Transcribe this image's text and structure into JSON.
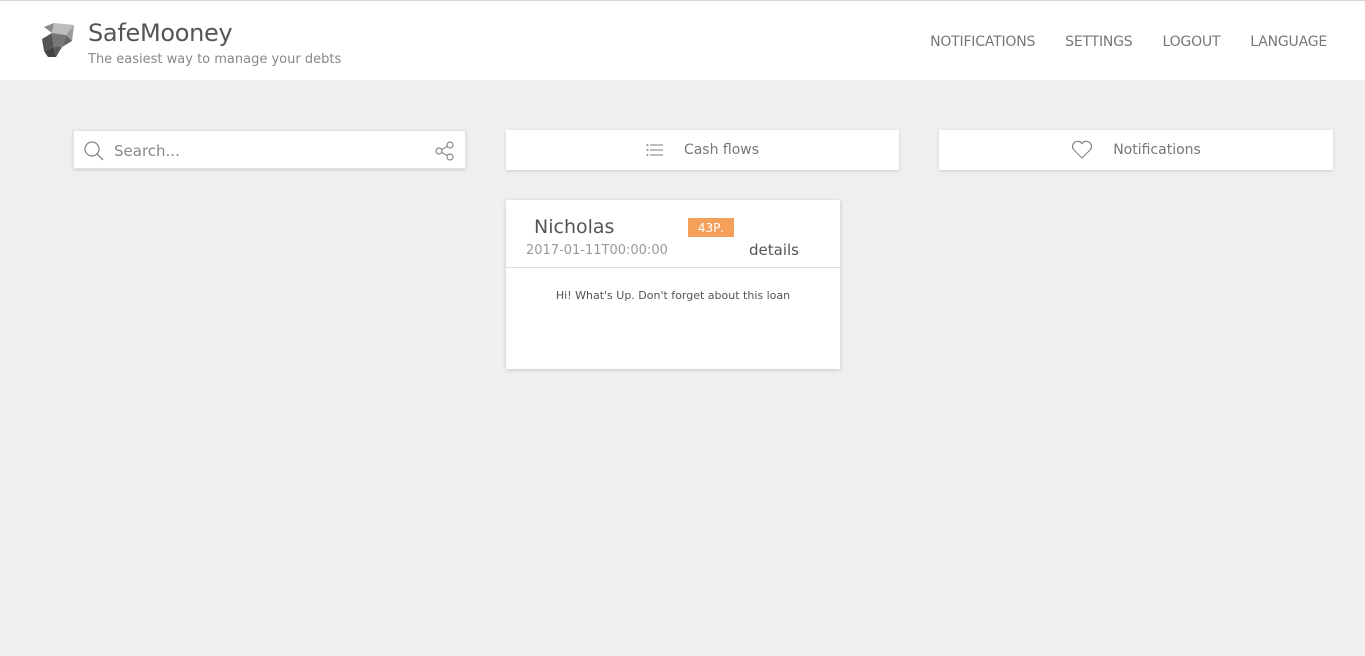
{
  "header": {
    "brand_title": "SafeMooney",
    "brand_subtitle": "The easiest way to manage your debts",
    "nav": [
      "NOTIFICATIONS",
      "SETTINGS",
      "LOGOUT",
      "LANGUAGE"
    ]
  },
  "toolbar": {
    "search_placeholder": "Search...",
    "cash_flows_label": "Cash flows",
    "notifications_label": "Notifications"
  },
  "card": {
    "name": "Nicholas",
    "badge": "43Р.",
    "date": "2017-01-11T00:00:00",
    "details_label": "details",
    "message": "Hi! What's Up. Don't forget about this loan"
  },
  "colors": {
    "background": "#efefef",
    "badge": "#f5a05a"
  }
}
